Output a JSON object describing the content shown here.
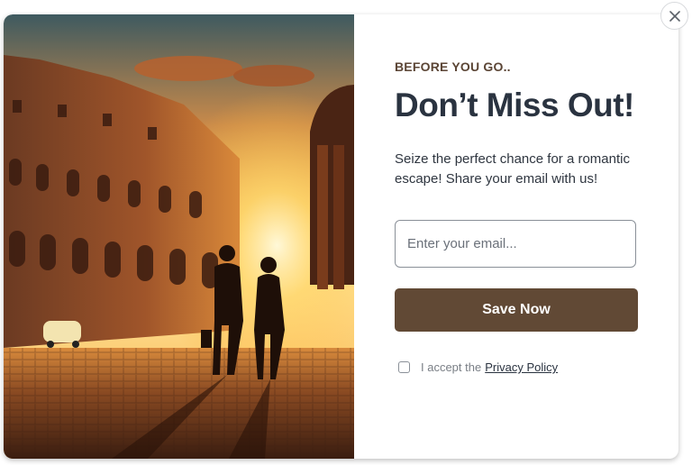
{
  "popup": {
    "eyebrow": "BEFORE YOU GO..",
    "headline": "Don’t Miss Out!",
    "description": "Seize the perfect chance for a romantic escape! Share your email with us!",
    "email_placeholder": "Enter your email...",
    "email_value": "",
    "save_label": "Save Now",
    "consent_text": "I accept the",
    "privacy_link": "Privacy Policy",
    "consent_checked": false
  },
  "image": {
    "description_icon": "colosseum-sunset-couple-photo"
  },
  "colors": {
    "button": "#614935",
    "eyebrow": "#5b4535",
    "headline": "#2a3340"
  }
}
